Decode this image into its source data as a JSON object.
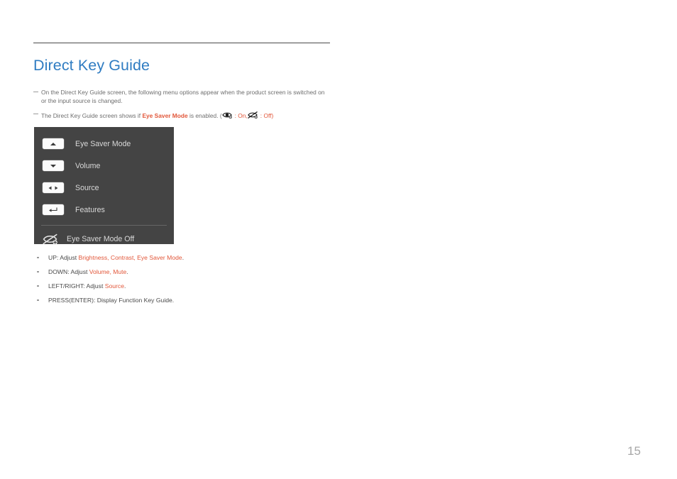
{
  "document": {
    "title": "Direct Key Guide",
    "page_number": "15",
    "accent_blue": "#2f7cc2",
    "accent_red": "#e2573a",
    "panel_bg": "#444444"
  },
  "notes": [
    {
      "text_before": "On the Direct Key Guide screen, the following menu options appear when the product screen is switched on or the input source is changed."
    },
    {
      "text_before": "The Direct Key Guide screen shows if ",
      "emphasis": "Eye Saver Mode",
      "text_after": " is enabled. (",
      "on_label": ": On,",
      "off_label": ": Off)",
      "on_icon": "eye-on-icon",
      "off_icon": "eye-off-icon"
    }
  ],
  "osd_panel": {
    "rows": [
      {
        "icon": "arrow-up-key-icon",
        "label": "Eye Saver Mode"
      },
      {
        "icon": "arrow-down-key-icon",
        "label": "Volume"
      },
      {
        "icon": "arrow-left-right-key-icon",
        "label": "Source"
      },
      {
        "icon": "enter-key-icon",
        "label": "Features"
      }
    ],
    "status": {
      "icon": "eye-off-icon",
      "label": "Eye Saver Mode Off"
    }
  },
  "bullets": [
    {
      "prefix": "UP: Adjust ",
      "accent": "Brightness, Contrast, Eye Saver Mode",
      "suffix": "."
    },
    {
      "prefix": "DOWN: Adjust ",
      "accent": "Volume, Mute",
      "suffix": "."
    },
    {
      "prefix": "LEFT/RIGHT: Adjust ",
      "accent": "Source",
      "suffix": "."
    },
    {
      "prefix": "PRESS(ENTER): Display Function Key Guide.",
      "accent": "",
      "suffix": ""
    }
  ]
}
